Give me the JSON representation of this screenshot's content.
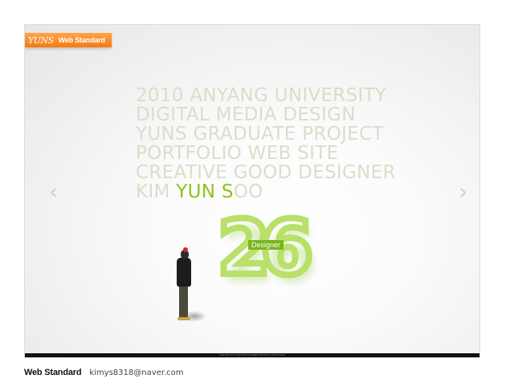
{
  "logo": {
    "mark": "YUNS",
    "label": "Web Standard",
    "accent_color": "#f37b15"
  },
  "headline": {
    "lines": [
      "2010 ANYANG UNIVERSITY",
      "DIGITAL MEDIA DESIGN",
      "YUNS GRADUATE PROJECT",
      "PORTFOLIO WEB SITE",
      "CREATIVE GOOD DESIGNER"
    ],
    "name_line": {
      "part1": "KIM ",
      "highlight1": "YUN",
      "space": " ",
      "highlight2": "S",
      "part2": "OO"
    },
    "text_color": "#dcdccb",
    "highlight_color": "#8ec21f"
  },
  "navigation": {
    "prev_icon": "chevron-left-icon",
    "next_icon": "chevron-right-icon",
    "prev_glyph": "‹",
    "next_glyph": "›"
  },
  "feature": {
    "number": "26",
    "tag": "Designer",
    "number_color": "#a4d43f"
  },
  "footer": {
    "copyright": "COPYRIGHT© KIMYUNSOO WEB PORTFOLIO SINCE 2010"
  },
  "credit": {
    "label": "Web Standard",
    "email": "kimys8318@naver.com"
  }
}
